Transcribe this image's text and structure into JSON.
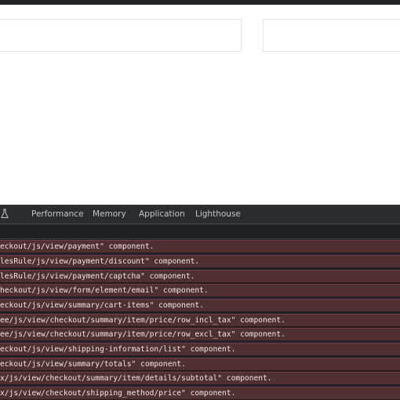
{
  "devtools": {
    "tabs": [
      {
        "label": "Performance"
      },
      {
        "label": "Memory"
      },
      {
        "label": "Application"
      },
      {
        "label": "Lighthouse"
      }
    ],
    "icon": "flask-icon"
  },
  "console": {
    "messages": [
      "eckout/js/view/payment\" component.",
      "lesRule/js/view/payment/discount\" component.",
      "lesRule/js/view/payment/captcha\" component.",
      "heckout/js/view/form/element/email\" component.",
      "eckout/js/view/summary/cart-items\" component.",
      "ee/js/view/checkout/summary/item/price/row_incl_tax\" component.",
      "ee/js/view/checkout/summary/item/price/row_excl_tax\" component.",
      "eckout/js/view/shipping-information/list\" component.",
      "eckout/js/view/summary/totals\" component.",
      "x/js/view/checkout/summary/item/details/subtotal\" component.",
      "x/js/view/checkout/shipping_method/price\" component."
    ]
  },
  "colors": {
    "error_row_bg": "#4e2f32",
    "devtools_bg": "#202124",
    "tab_text": "#c4c7ca"
  }
}
